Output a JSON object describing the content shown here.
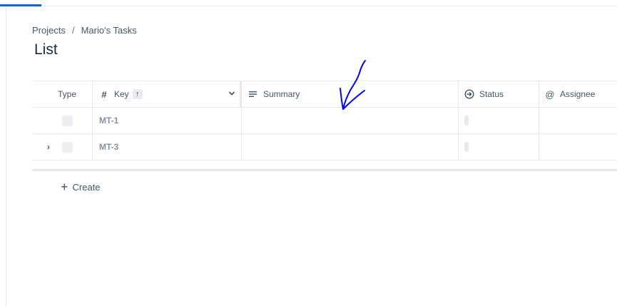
{
  "breadcrumb": {
    "project": "Projects",
    "separator": "/",
    "current": "Mario's Tasks"
  },
  "page": {
    "title": "List"
  },
  "table": {
    "columns": {
      "type": "Type",
      "key": "Key",
      "summary": "Summary",
      "status": "Status",
      "assignee": "Assignee"
    },
    "icons": {
      "key": "#",
      "summary": "≡",
      "assignee": "@",
      "sort": "↑",
      "dropdown": "⌄"
    },
    "rows": [
      {
        "key": "MT-1",
        "expandable": false
      },
      {
        "key": "MT-3",
        "expandable": true,
        "chevron": "›"
      }
    ]
  },
  "actions": {
    "create_label": "Create",
    "create_icon": "+"
  },
  "colors": {
    "accent": "#0c66e4",
    "annotation": "#0000ff"
  }
}
